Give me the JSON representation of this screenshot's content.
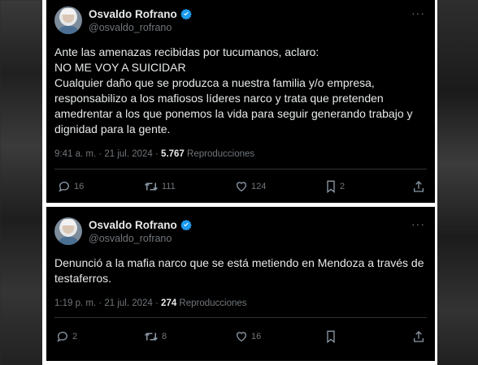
{
  "tweets": [
    {
      "author": {
        "name": "Osvaldo Rofrano",
        "handle": "@osvaldo_rofrano"
      },
      "more_label": "···",
      "text": "Ante las amenazas recibidas por tucumanos, aclaro:\nNO ME VOY A SUICIDAR\nCualquier daño que se produzca a nuestra familia y/o empresa, responsabilizo a los mafiosos líderes narco y trata que pretenden amedrentar a los que ponemos la vida para seguir generando trabajo y dignidad para la gente.",
      "time": "9:41 a. m. · 21 jul. 2024 · ",
      "views": "5.767",
      "views_label": " Reproducciones",
      "replies": "16",
      "retweets": "111",
      "likes": "124",
      "bookmarks": "2",
      "icons": [
        "reply-icon",
        "retweet-icon",
        "like-icon",
        "bookmark-icon",
        "share-icon"
      ]
    },
    {
      "author": {
        "name": "Osvaldo Rofrano",
        "handle": "@osvaldo_rofrano"
      },
      "more_label": "···",
      "text": "Denunció a la mafia narco que se está metiendo en Mendoza a través de testaferros.",
      "time": "1:19 p. m. · 21 jul. 2024 · ",
      "views": "274",
      "views_label": " Reproducciones",
      "replies": "2",
      "retweets": "8",
      "likes": "16",
      "bookmarks": "",
      "icons": [
        "reply-icon",
        "retweet-icon",
        "like-icon",
        "bookmark-icon",
        "share-icon"
      ]
    }
  ],
  "colors": {
    "background": "#000000",
    "text": "#e7e9ea",
    "muted": "#71767b",
    "verified": "#1d9bf0",
    "divider": "#2f3336"
  }
}
